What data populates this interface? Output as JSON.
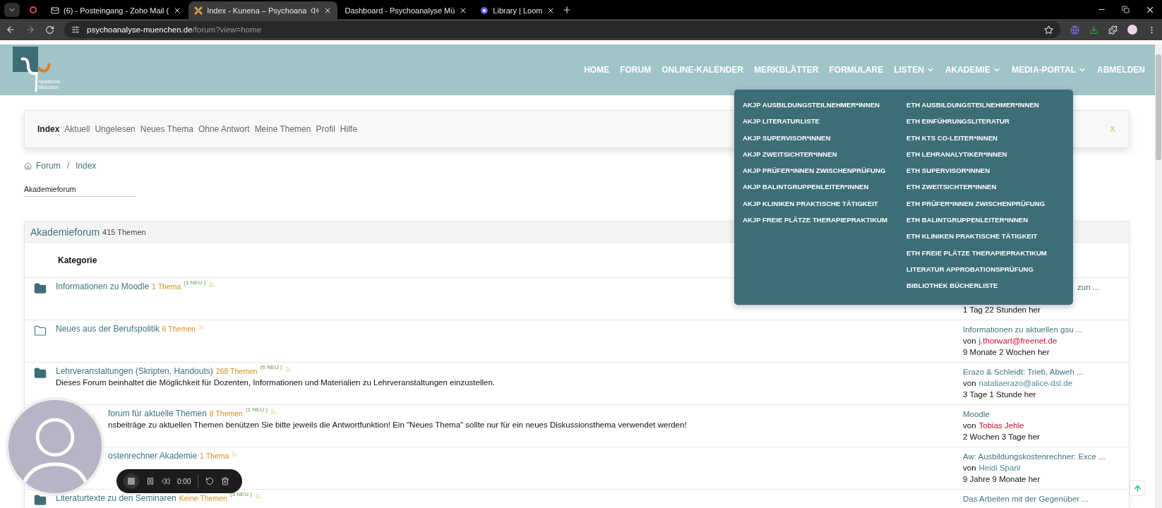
{
  "browser": {
    "tabs": [
      {
        "title": "(6) - Posteingang - Zoho Mail (",
        "selected": false,
        "kind": "mail"
      },
      {
        "title": "Index - Kunena – Psychoana",
        "selected": true,
        "kind": "site",
        "audio": true
      },
      {
        "title": "Dashboard - Psychoanalyse Mü",
        "selected": false,
        "kind": "blank"
      },
      {
        "title": "Library | Loom",
        "selected": false,
        "kind": "loom"
      }
    ],
    "url_domain": "psychoanalyse-muenchen.de",
    "url_path": "/forum?view=home"
  },
  "site": {
    "logo_lines": [
      "Akademie",
      "München"
    ],
    "nav": [
      {
        "label": "HOME",
        "has_menu": false
      },
      {
        "label": "FORUM",
        "has_menu": false
      },
      {
        "label": "ONLINE-KALENDER",
        "has_menu": false
      },
      {
        "label": "MERKBLÄTTER",
        "has_menu": false
      },
      {
        "label": "FORMULARE",
        "has_menu": false
      },
      {
        "label": "LISTEN",
        "has_menu": true
      },
      {
        "label": "AKADEMIE",
        "has_menu": true
      },
      {
        "label": "MEDIA-PORTAL",
        "has_menu": true
      },
      {
        "label": "ABMELDEN",
        "has_menu": false
      }
    ]
  },
  "mega_menu": {
    "columns": [
      [
        "AKJP AUSBILDUNGSTEILNEHMER*INNEN",
        "AKJP LITERATURLISTE",
        "AKJP SUPERVISOR*INNEN",
        "AKJP ZWEITSICHTER*INNEN",
        "AKJP PRÜFER*INNEN ZWISCHENPRÜFUNG",
        "AKJP BALINTGRUPPENLEITER*INNEN",
        "AKJP KLINIKEN PRAKTISCHE TÄTIGKEIT",
        "AKJP FREIE PLÄTZE THERAPIEPRAKTIKUM"
      ],
      [
        "ETH AUSBILDUNGSTEILNEHMER*INNEN",
        "ETH EINFÜHRUNGSLITERATUR",
        "ETH KTS CO-LEITER*INNEN",
        "ETH LEHRANALYTIKER*INNEN",
        "ETH SUPERVISOR*INNEN",
        "ETH ZWEITSICHTER*INNEN",
        "ETH PRÜFER*INNEN ZWISCHENPRÜFUNG",
        "ETH BALINTGRUPPENLEITER*INNEN",
        "ETH KLINIKEN PRAKTISCHE TÄTIGKEIT",
        "ETH FREIE PLÄTZE THERAPIEPRAKTIKUM",
        "LITERATUR APPROBATIONSPRÜFUNG",
        "BIBLIOTHEK BÜCHERLISTE"
      ]
    ]
  },
  "forum_menu": {
    "items": [
      {
        "label": "Index",
        "selected": true
      },
      {
        "label": "Aktuell",
        "selected": false
      },
      {
        "label": "Ungelesen",
        "selected": false
      },
      {
        "label": "Neues Thema",
        "selected": false
      },
      {
        "label": "Ohne Antwort",
        "selected": false
      },
      {
        "label": "Meine Themen",
        "selected": false
      },
      {
        "label": "Profil",
        "selected": false
      },
      {
        "label": "Hilfe",
        "selected": false
      }
    ]
  },
  "breadcrumb": {
    "items": [
      "Forum",
      "Index"
    ],
    "separator": "/"
  },
  "category_select": {
    "value": "Akademieforum"
  },
  "section": {
    "title": "Akademieforum",
    "count": "415 Themen",
    "column_header": "Kategorie",
    "rows": [
      {
        "kind": "filled",
        "covered": false,
        "title": "Informationen zu Moodle",
        "count": "1 Thema",
        "new": "(1 NEU )",
        "last_post": {
          "title": "zun ...",
          "partial": true,
          "time": "1 Tag 22 Stunden her"
        }
      },
      {
        "kind": "outline",
        "covered": false,
        "title": "Neues aus der Berufspolitik",
        "count": "6 Themen",
        "last_post": {
          "title": "Informationen zu aktuellen gsu ...",
          "by": "von",
          "author": "j.thorwart@freenet.de",
          "color": "#c8102e",
          "time": "9 Monate 2 Wochen her"
        }
      },
      {
        "kind": "filled",
        "covered": false,
        "title": "Lehrveranstaltungen (Skripten, Handouts)",
        "count": "268 Themen",
        "new": "(6 NEU )",
        "description": "Dieses Forum beinhaltet die Möglichkeit für Dozenten, Informationen und Materialien zu Lehrveranstaltungen einzustellen.",
        "last_post": {
          "title": "Erazo & Schleidt: Trieb, Abweh ...",
          "by": "von",
          "author": "nataliaerazo@alice-dsl.de",
          "color": "#4a8a9a",
          "time": "3 Tage 1 Stunde her"
        }
      },
      {
        "kind": "hidden",
        "covered": true,
        "title": "forum für aktuelle Themen",
        "count": "8 Themen",
        "new": "(1 NEU )",
        "description": "nsbeiträge zu aktuellen Themen benützen Sie bitte jeweils die Antwortfunktion! Ein \"Neues Thema\" sollte nur für ein neues Diskussionsthema verwendet werden!",
        "last_post": {
          "title": "Moodle",
          "by": "von",
          "author": "Tobias Jehle",
          "color": "#c8102e",
          "time": "2 Wochen 3 Tage her"
        }
      },
      {
        "kind": "hidden",
        "covered": true,
        "title": "ostenrechner Akademie",
        "count": "1 Thema",
        "last_post": {
          "title": "Aw: Ausbildungskostenrechner: Exce ...",
          "by": "von",
          "author": "Heidi Spanl",
          "color": "#4a8a9a",
          "time": "9 Jahre 9 Monate her"
        }
      },
      {
        "kind": "filled",
        "covered": false,
        "title": "Literaturtexte zu den Seminaren",
        "count": "Keine Themen",
        "new": "(3 NEU )",
        "last_post": {
          "title": "Das Arbeiten mit der Gegenüber ..."
        }
      }
    ]
  },
  "recorder": {
    "time": "0:00"
  }
}
